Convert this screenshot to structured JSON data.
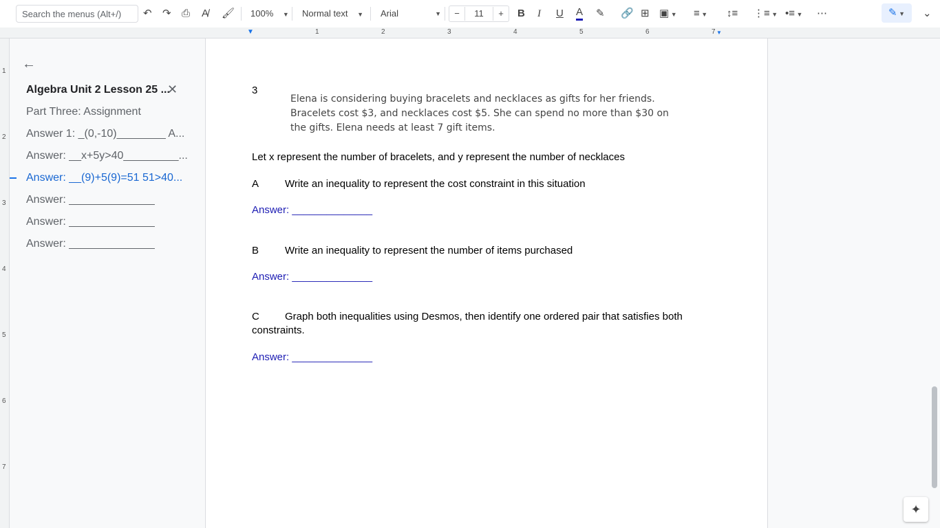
{
  "toolbar": {
    "search_placeholder": "Search the menus (Alt+/)",
    "zoom": "100%",
    "style": "Normal text",
    "font": "Arial",
    "font_size": "11"
  },
  "ruler": [
    "1",
    "2",
    "3",
    "4",
    "5",
    "6",
    "7"
  ],
  "vruler": [
    "1",
    "2",
    "3",
    "4",
    "5",
    "6",
    "7"
  ],
  "outline": {
    "title": "Algebra Unit 2 Lesson 25 ...",
    "items": [
      "Part Three: Assignment",
      "Answer 1: _(0,-10)________ A...",
      "Answer: __x+5y>40_________...",
      "Answer: __(9)+5(9)=51 51>40...",
      "Answer: ______________",
      "Answer: ______________",
      "Answer: ______________"
    ]
  },
  "doc": {
    "number": "3",
    "problem": "Elena is considering buying bracelets and necklaces as gifts for her friends. Bracelets cost $3, and necklaces cost $5. She can spend no more than $30 on the gifts. Elena needs at least 7 gift items.",
    "intro": "Let x represent the number of bracelets, and y represent the number of necklaces",
    "a_label": "A",
    "a_text": "Write an inequality to represent the cost constraint in this situation",
    "b_label": "B",
    "b_text": "Write an inequality to represent the number of items purchased",
    "c_label": "C",
    "c_text": "Graph both inequalities using Desmos, then identify one ordered pair that satisfies both",
    "c_text2": "constraints.",
    "answer": "Answer:  ______________"
  }
}
